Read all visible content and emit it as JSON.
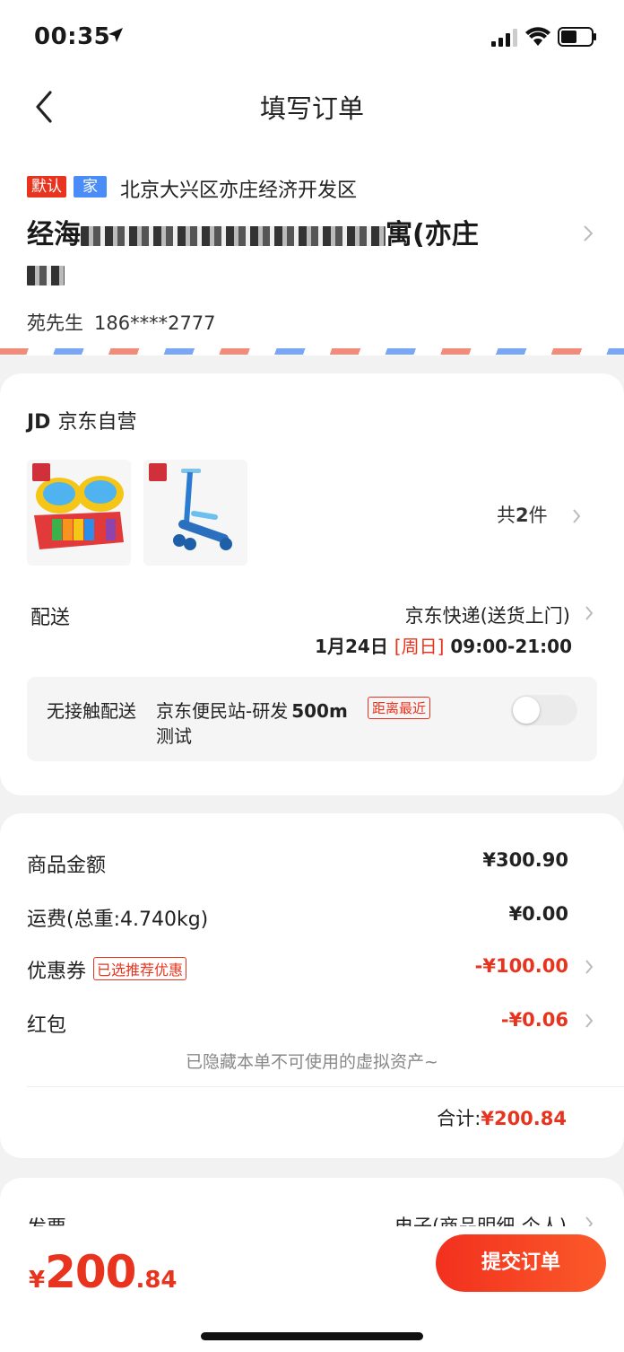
{
  "status_bar": {
    "time": "00:35"
  },
  "nav": {
    "title": "填写订单"
  },
  "address": {
    "tag_default": "默认",
    "tag_home": "家",
    "region": "北京大兴区亦庄经济开发区",
    "detail_prefix": "经海",
    "detail_suffix": "寓(亦庄",
    "name": "苑先生",
    "phone": "186****2777"
  },
  "shop": {
    "logo": "JD",
    "name": "京东自营",
    "count_prefix": "共",
    "count_num": "2",
    "count_suffix": "件"
  },
  "shipping": {
    "label": "配送",
    "method": "京东快递(送货上门)",
    "date": "1月24日",
    "weekday": "[周日]",
    "window": "09:00-21:00"
  },
  "pickup": {
    "label": "无接触配送",
    "station": "京东便民站-研发",
    "distance": "500m",
    "note": "测试",
    "badge": "距离最近"
  },
  "price": {
    "goods_label": "商品金额",
    "goods_value": "¥300.90",
    "freight_label": "运费(总重:4.740kg)",
    "freight_value": "¥0.00",
    "coupon_label": "优惠券",
    "coupon_tag": "已选推荐优惠",
    "coupon_value": "-¥100.00",
    "redpack_label": "红包",
    "redpack_value": "-¥0.06",
    "hidden_note": "已隐藏本单不可使用的虚拟资产",
    "total_label": "合计:",
    "total_value": "¥200.84"
  },
  "invoice": {
    "label": "发票",
    "value": "电子(商品明细-个人)"
  },
  "footer": {
    "currency": "¥",
    "amount_int": "200",
    "amount_dec": ".84",
    "submit": "提交订单"
  },
  "colors": {
    "accent": "#e8341e",
    "tag_blue": "#4b8df8"
  }
}
